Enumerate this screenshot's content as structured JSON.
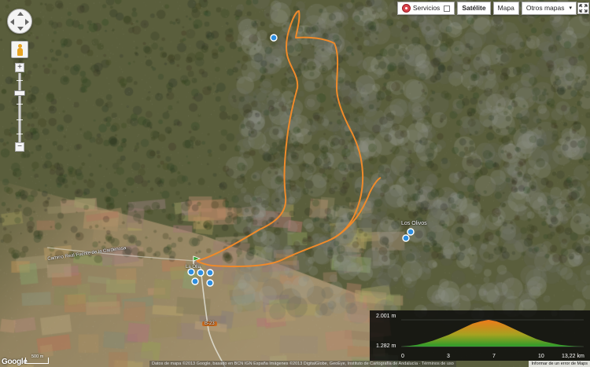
{
  "map_type": {
    "services_label": "Servicios",
    "satellite_label": "Satélite",
    "map_label": "Mapa",
    "other_maps_label": "Otros mapas"
  },
  "zoom": {
    "plus": "+",
    "minus": "−"
  },
  "labels": {
    "road": "Camino Real Fuente de la Cardenosa",
    "village": "Los Olivos",
    "town": "La Olla",
    "road_sign": "B-23"
  },
  "elevation": {
    "max_label": "2.001 m",
    "min_label": "1.282 m",
    "ticks": [
      "0",
      "3",
      "7",
      "10",
      "13,22 km"
    ],
    "profile": [
      1282,
      1300,
      1330,
      1380,
      1440,
      1520,
      1600,
      1700,
      1800,
      1900,
      1960,
      2001,
      1960,
      1880,
      1780,
      1680,
      1580,
      1490,
      1420,
      1370,
      1330,
      1305,
      1290,
      1282
    ]
  },
  "footer": {
    "google": "Google",
    "scale": "500 m",
    "attribution": "Datos de mapa ©2013 Google, basado en BCN IGN España Imágenes ©2013 DigitalGlobe, GeoEye, Instituto de Cartografía de Andalucía · Términos de uso",
    "report": "Informar de un error de Maps"
  },
  "colors": {
    "route": "#f08a2a",
    "marker_green": "#34a02f",
    "poi_blue": "#2d8ee0"
  }
}
